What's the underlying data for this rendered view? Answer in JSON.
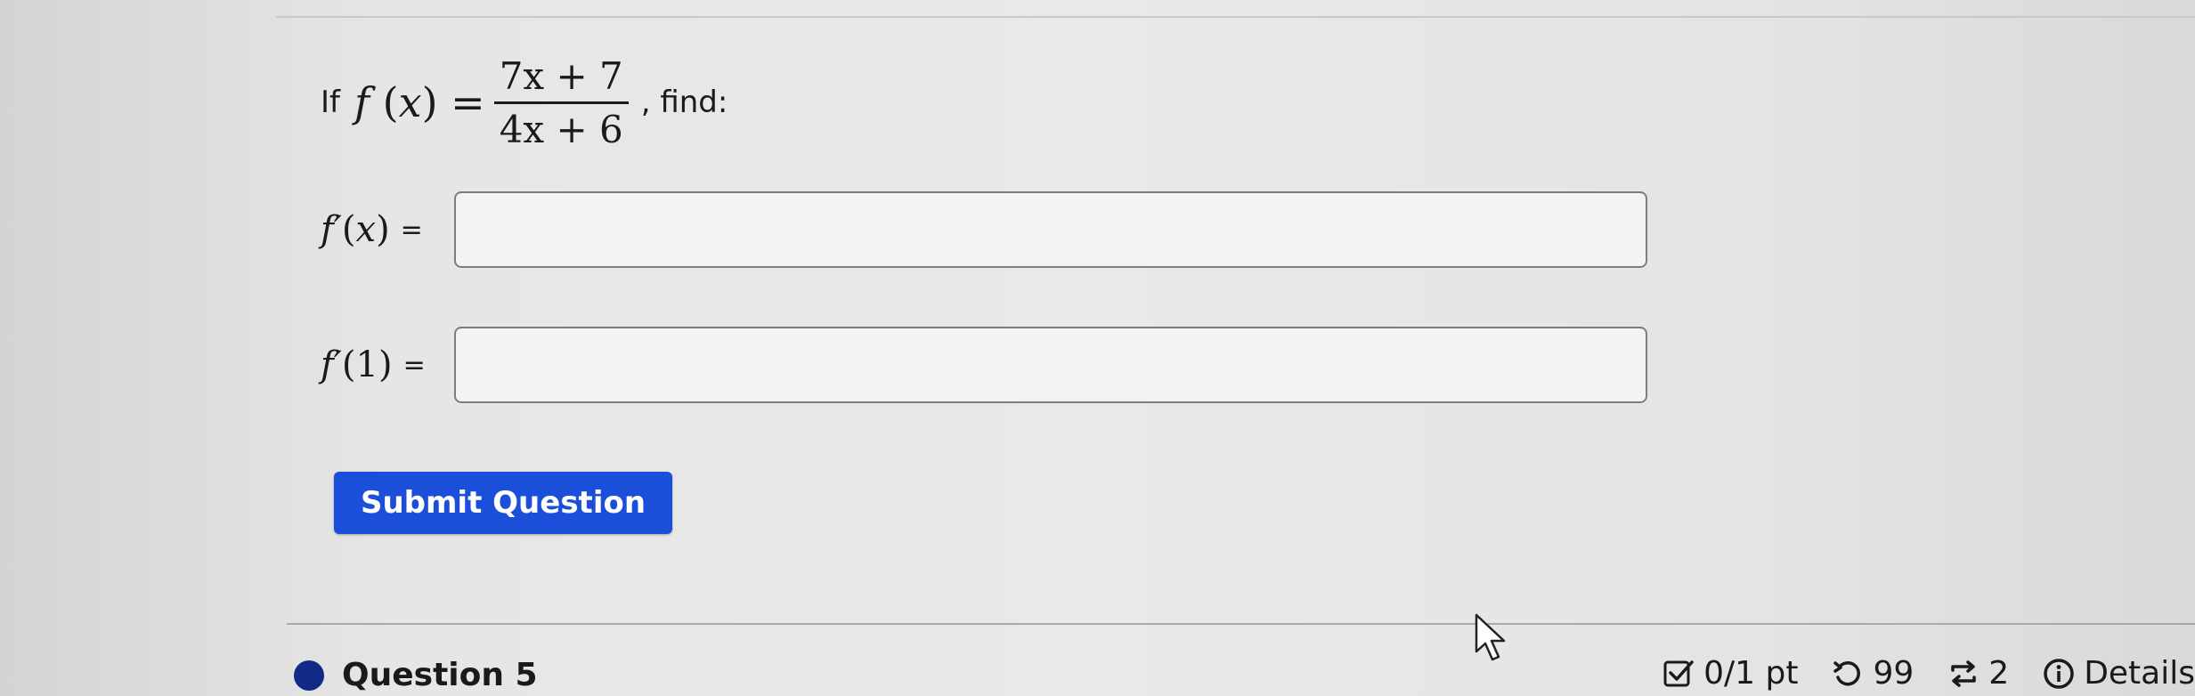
{
  "question": {
    "if_word": "If",
    "fn_name": "f",
    "fn_var": "x",
    "numerator": "7x + 7",
    "denominator": "4x + 6",
    "find_text": ", find:"
  },
  "fields": [
    {
      "label_fn": "f′",
      "label_arg": "x",
      "equals": "=",
      "value": "",
      "placeholder": ""
    },
    {
      "label_fn": "f′",
      "label_arg": "1",
      "equals": "=",
      "value": "",
      "placeholder": ""
    }
  ],
  "submit_label": "Submit Question",
  "footer": {
    "question_label": "Question 5",
    "points": "0/1 pt",
    "retries": "99",
    "attempts": "2",
    "details": "Details"
  },
  "colors": {
    "button": "#1b4fd9",
    "question_dot": "#102a86"
  },
  "icons": [
    "checkbox-icon",
    "retry-icon",
    "attempts-icon",
    "info-icon",
    "mouse-cursor-icon"
  ]
}
